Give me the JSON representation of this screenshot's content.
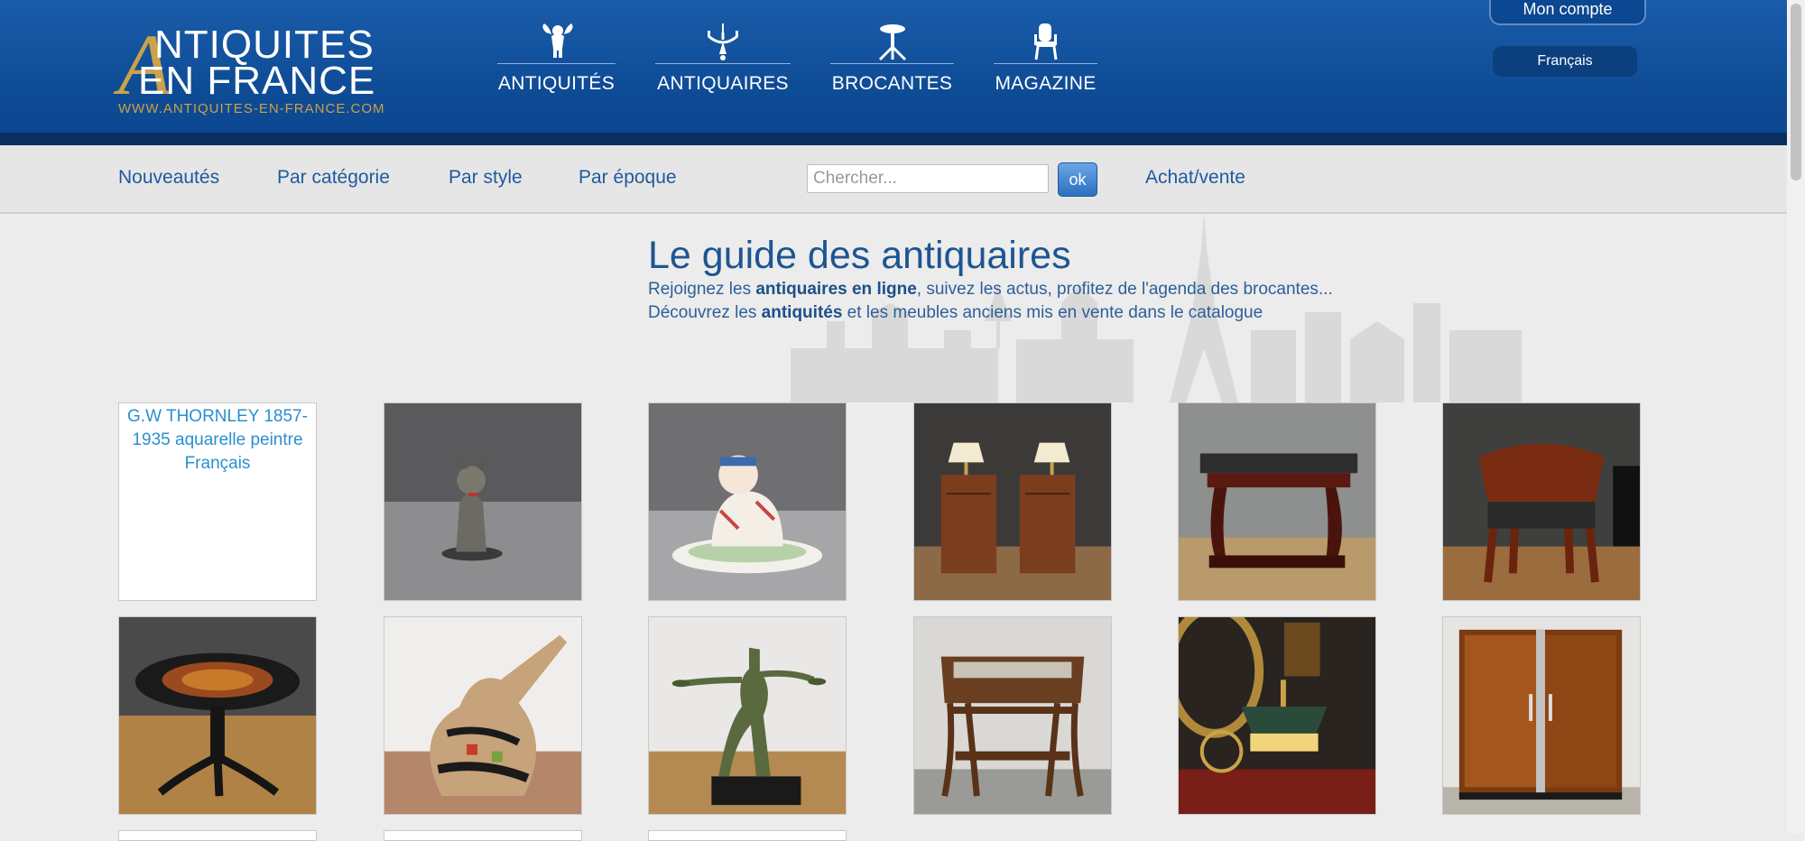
{
  "header": {
    "logo": {
      "letter": "A",
      "line1": "NTIQUITES",
      "line2": "EN FRANCE",
      "url": "WWW.ANTIQUITES-EN-FRANCE.COM"
    },
    "nav": [
      {
        "label": "ANTIQUITÉS",
        "icon": "cherub-icon"
      },
      {
        "label": "ANTIQUAIRES",
        "icon": "chandelier-icon"
      },
      {
        "label": "BROCANTES",
        "icon": "gueridon-table-icon"
      },
      {
        "label": "MAGAZINE",
        "icon": "armchair-icon"
      }
    ],
    "account_label": "Mon compte",
    "language": "Français"
  },
  "subnav": {
    "links": [
      "Nouveautés",
      "Par catégorie",
      "Par style",
      "Par époque"
    ],
    "search_placeholder": "Chercher...",
    "search_button": "ok",
    "buy_sell": "Achat/vente"
  },
  "guide": {
    "title": "Le guide des antiquaires",
    "line1_pre": "Rejoignez les ",
    "line1_bold": "antiquaires en ligne",
    "line1_post": ", suivez les actus, profitez de l'agenda des brocantes...",
    "line2_pre": "Découvrez les ",
    "line2_bold": "antiquités",
    "line2_post": " et les meubles anciens mis en vente dans le catalogue"
  },
  "products": [
    {
      "alt": "G.W THORNLEY 1857-1935 aquarelle peintre Français",
      "image": "broken-image"
    },
    {
      "image": "dog-figurine"
    },
    {
      "image": "porcelain-child-figure"
    },
    {
      "image": "pair-bedside-tables-lamps"
    },
    {
      "image": "marble-top-console"
    },
    {
      "image": "mahogany-armchair"
    },
    {
      "image": "tripod-pedestal-table"
    },
    {
      "image": "decorated-ceramic-pitcher"
    },
    {
      "image": "art-deco-bronze-dancer"
    },
    {
      "image": "marble-top-side-table"
    },
    {
      "image": "bouillotte-lamp-scene"
    },
    {
      "image": "burl-wood-cabinet"
    }
  ],
  "colors": {
    "header_blue": "#0f4c96",
    "link_blue": "#1f5aa0",
    "logo_gold": "#c9a24a"
  }
}
